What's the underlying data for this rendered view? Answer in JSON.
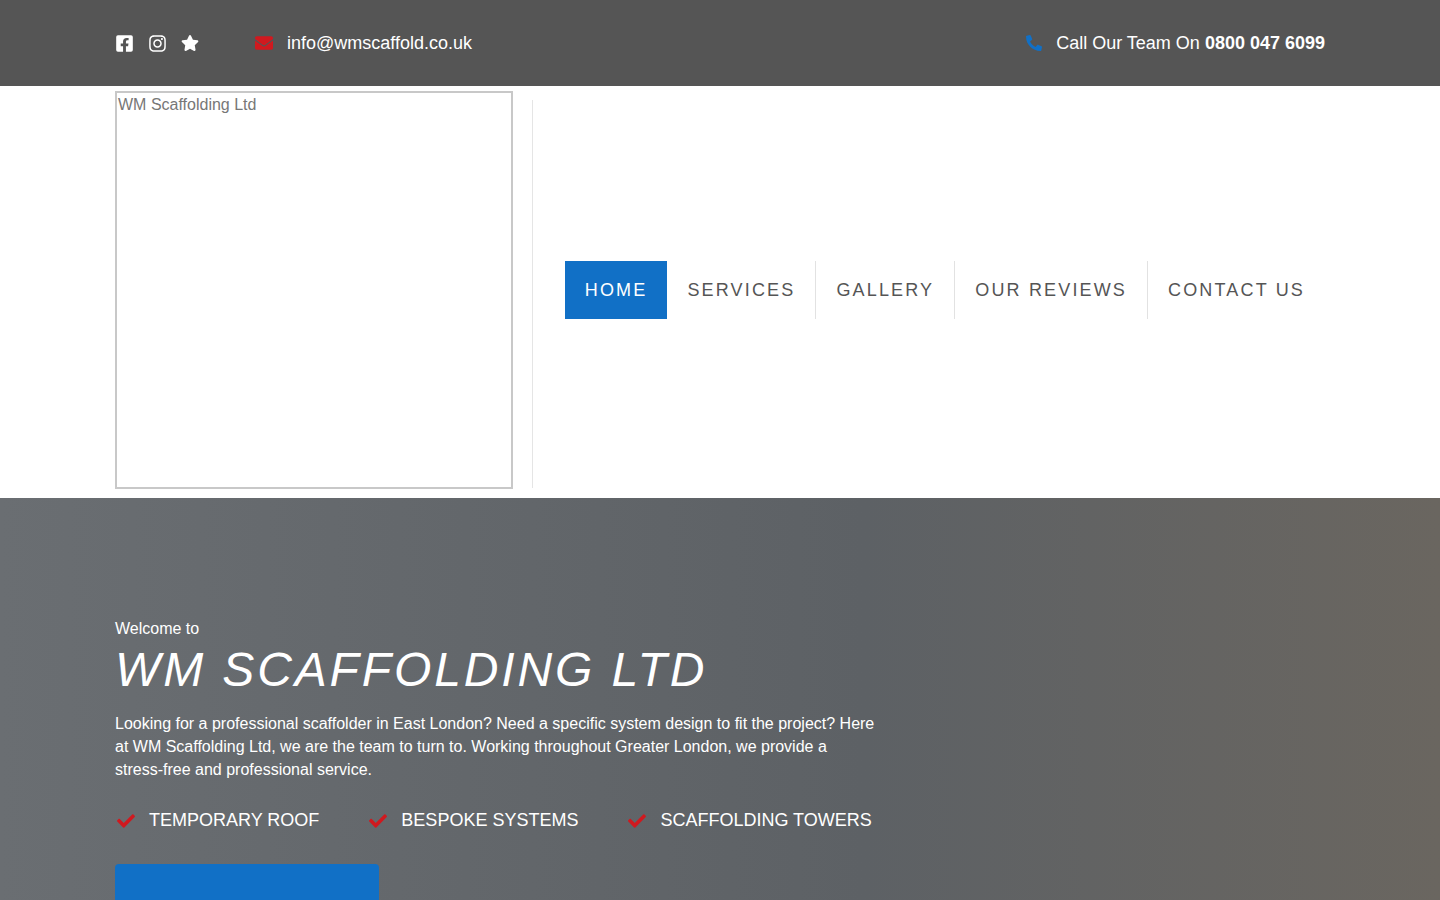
{
  "top_bar": {
    "email": "info@wmscaffold.co.uk",
    "phone_label": "Call Our Team On ",
    "phone_number": "0800 047 6099"
  },
  "logo": {
    "alt": "WM Scaffolding Ltd"
  },
  "nav": [
    {
      "label": "HOME",
      "selected": true
    },
    {
      "label": "SERVICES",
      "selected": false
    },
    {
      "label": "GALLERY",
      "selected": false
    },
    {
      "label": "OUR REVIEWS",
      "selected": false
    },
    {
      "label": "CONTACT US",
      "selected": false
    }
  ],
  "hero": {
    "welcome": "Welcome to",
    "title": "WM SCAFFOLDING LTD",
    "description": "Looking for a professional scaffolder in East London? Need a specific system design to fit the project? Here at WM Scaffolding Ltd, we are the team to turn to. Working throughout Greater London, we provide a stress-free and professional service.",
    "features": [
      "TEMPORARY ROOF",
      "BESPOKE SYSTEMS",
      "SCAFFOLDING TOWERS"
    ]
  }
}
